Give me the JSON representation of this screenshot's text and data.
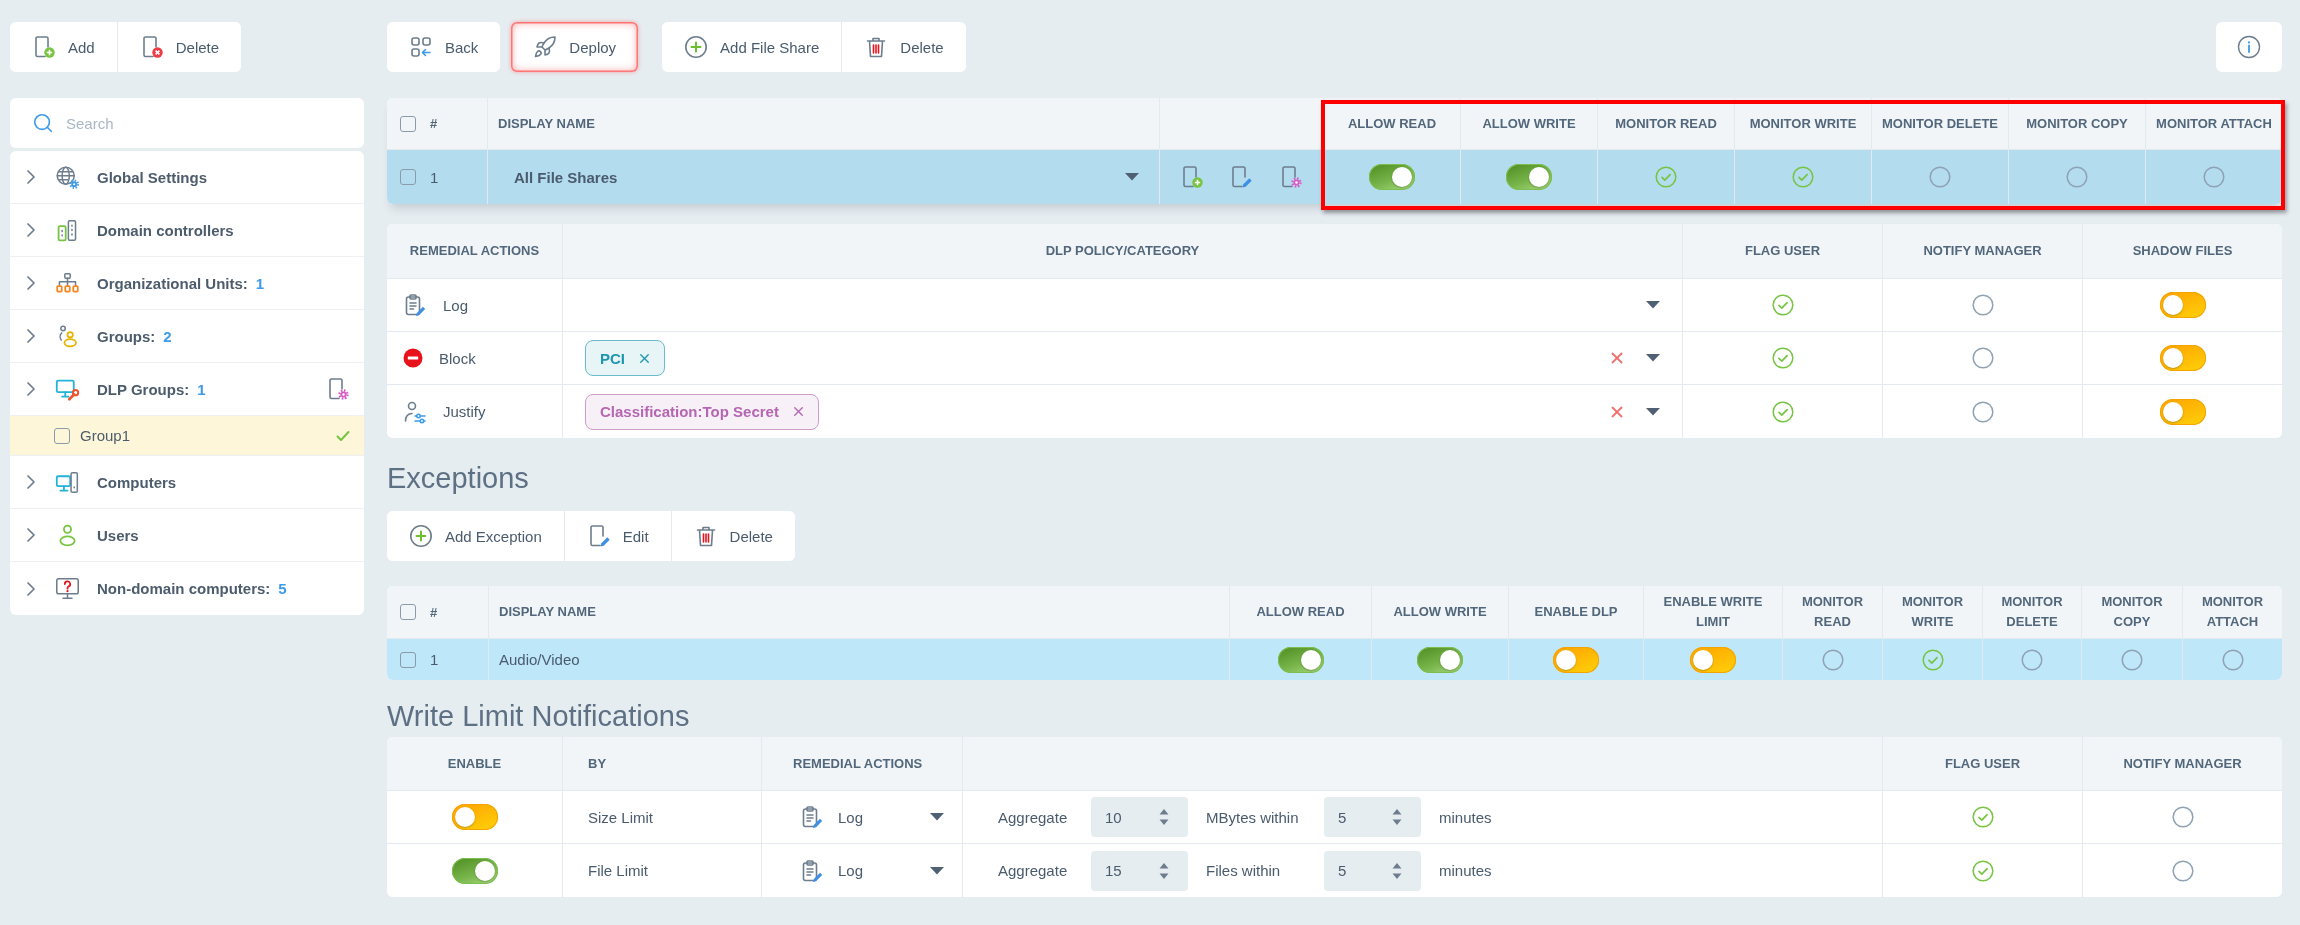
{
  "sidebar": {
    "toolbar": [
      {
        "label": "Add",
        "kind": "add"
      },
      {
        "label": "Delete",
        "kind": "delete"
      }
    ],
    "search": {
      "placeholder": "Search"
    },
    "items": [
      {
        "label": "Global Settings",
        "kind": "settings",
        "settings_button": false
      },
      {
        "label": "Domain controllers",
        "kind": "servers",
        "settings_button": false
      },
      {
        "label": "Organizational Units:",
        "count": "1",
        "kind": "units",
        "settings_button": false
      },
      {
        "label": "Groups:",
        "count": "2",
        "kind": "groups",
        "settings_button": false
      },
      {
        "label": "DLP Groups:",
        "count": "1",
        "kind": "dlp",
        "settings_button": true,
        "children": [
          {
            "label": "Group1",
            "checked": false,
            "selected": true
          }
        ]
      },
      {
        "label": "Computers",
        "kind": "computers",
        "settings_button": false
      },
      {
        "label": "Users",
        "kind": "users",
        "settings_button": false
      },
      {
        "label": "Non-domain computers:",
        "count": "5",
        "kind": "unknown",
        "settings_button": false
      }
    ]
  },
  "toolbar": {
    "groups": [
      [
        {
          "label": "Back",
          "kind": "back",
          "highlighted": false
        }
      ],
      [
        {
          "label": "Deploy",
          "kind": "deploy",
          "highlighted": true
        }
      ],
      [
        {
          "label": "Add File Share",
          "kind": "add",
          "highlighted": false
        },
        {
          "label": "Delete",
          "kind": "delete",
          "highlighted": false
        }
      ]
    ]
  },
  "file_shares": {
    "all_checked": false,
    "highlighted": true,
    "columns": [
      {
        "label": "#",
        "kind": "number"
      },
      {
        "label": "DISPLAY NAME",
        "kind": "name"
      },
      {
        "label": "ALLOW READ",
        "kind": "toggle"
      },
      {
        "label": "ALLOW WRITE",
        "kind": "toggle"
      },
      {
        "label": "MONITOR READ",
        "kind": "check"
      },
      {
        "label": "MONITOR WRITE",
        "kind": "check"
      },
      {
        "label": "MONITOR DELETE",
        "kind": "check"
      },
      {
        "label": "MONITOR COPY",
        "kind": "check"
      },
      {
        "label": "MONITOR ATTACH",
        "kind": "check"
      }
    ],
    "rows": [
      {
        "checked": false,
        "selected": true,
        "number": "1",
        "name": "All File Shares",
        "values": [
          true,
          true,
          true,
          true,
          false,
          false,
          false
        ]
      }
    ]
  },
  "remedial_actions": {
    "columns": [
      {
        "label": "REMEDIAL ACTIONS",
        "kind": "action"
      },
      {
        "label": "DLP POLICY/CATEGORY",
        "kind": "tags"
      },
      {
        "label": "FLAG USER",
        "kind": "check"
      },
      {
        "label": "NOTIFY MANAGER",
        "kind": "check"
      },
      {
        "label": "SHADOW FILES",
        "kind": "toggle"
      }
    ],
    "rows": [
      {
        "label": "Log",
        "kind": "log",
        "values": [
          true,
          false,
          false
        ]
      },
      {
        "label": "Block",
        "kind": "block",
        "tags": [
          {
            "label": "PCI",
            "color": "#1c97b0"
          }
        ],
        "values": [
          true,
          false,
          false
        ]
      },
      {
        "label": "Justify",
        "kind": "justify",
        "tags": [
          {
            "label": "Classification:Top Secret",
            "color": "#b566b3"
          }
        ],
        "values": [
          true,
          false,
          false
        ]
      }
    ]
  },
  "exceptions": {
    "title": "Exceptions",
    "toolbar": [
      {
        "label": "Add Exception",
        "kind": "add",
        "highlighted": false
      },
      {
        "label": "Edit",
        "kind": "edit",
        "highlighted": false
      },
      {
        "label": "Delete",
        "kind": "delete",
        "highlighted": false
      }
    ],
    "table": {
      "all_checked": false,
      "columns": [
        {
          "label": "#",
          "kind": "number"
        },
        {
          "label": "DISPLAY NAME",
          "kind": "name"
        },
        {
          "label": "ALLOW READ",
          "kind": "toggle"
        },
        {
          "label": "ALLOW WRITE",
          "kind": "toggle"
        },
        {
          "label": "ENABLE DLP",
          "kind": "toggle"
        },
        {
          "label": "ENABLE WRITE LIMIT",
          "kind": "toggle"
        },
        {
          "label": "MONITOR READ",
          "kind": "check"
        },
        {
          "label": "MONITOR WRITE",
          "kind": "check"
        },
        {
          "label": "MONITOR DELETE",
          "kind": "check"
        },
        {
          "label": "MONITOR COPY",
          "kind": "check"
        },
        {
          "label": "MONITOR ATTACH",
          "kind": "check"
        }
      ],
      "rows": [
        {
          "checked": false,
          "selected": true,
          "number": "1",
          "name": "Audio/Video",
          "values": [
            true,
            true,
            false,
            false,
            false,
            true,
            false,
            false,
            false
          ]
        }
      ]
    }
  },
  "write_limit_notifications": {
    "title": "Write Limit Notifications",
    "columns": [
      {
        "label": "ENABLE",
        "kind": "toggle"
      },
      {
        "label": "BY",
        "kind": "text"
      },
      {
        "label": "REMEDIAL ACTIONS",
        "kind": "select"
      },
      {
        "label": "FLAG USER",
        "kind": "check"
      },
      {
        "label": "NOTIFY MANAGER",
        "kind": "check"
      }
    ],
    "rows": [
      {
        "enabled": false,
        "by": "Size Limit",
        "action": {
          "label": "Log",
          "kind": "log"
        },
        "limit": {
          "prefix": "Aggregate",
          "amount": "10",
          "unit": "MBytes within",
          "period": "5",
          "suffix": "minutes"
        },
        "flag_user": true,
        "notify_manager": false
      },
      {
        "enabled": true,
        "by": "File Limit",
        "action": {
          "label": "Log",
          "kind": "log"
        },
        "limit": {
          "prefix": "Aggregate",
          "amount": "15",
          "unit": "Files within",
          "period": "5",
          "suffix": "minutes"
        },
        "flag_user": true,
        "notify_manager": false
      }
    ]
  }
}
